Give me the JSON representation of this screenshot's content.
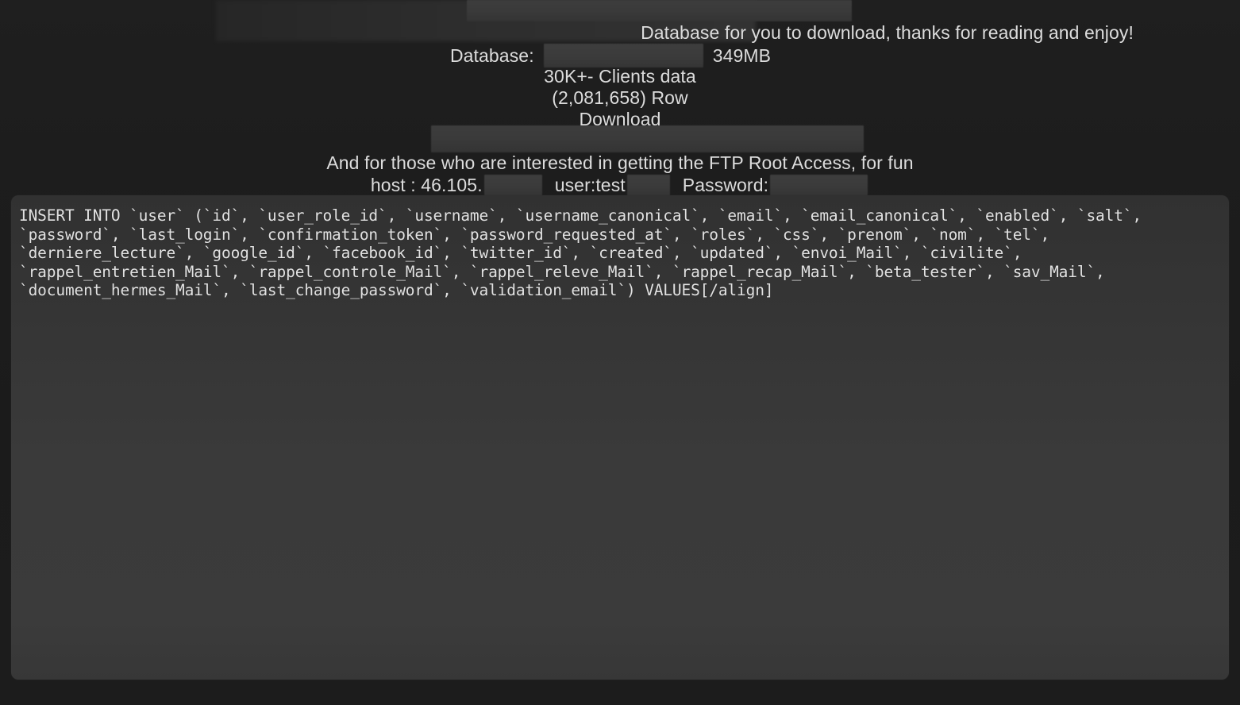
{
  "post": {
    "headline": "Database for you to download, thanks for reading and enjoy!",
    "database_label": "Database:",
    "database_name_redacted": "",
    "database_size": "349MB",
    "clients_count": "30K+- Clients data",
    "rows_count": "(2,081,658) Row",
    "download_label": "Download",
    "ftp_intro": "And for those who are interested in getting the FTP Root Access, for fun",
    "ftp": {
      "host_label": "host : 46.105.",
      "host_redacted": "",
      "user_label": "user:test",
      "user_redacted": "",
      "password_label": "Password:",
      "password_redacted": ""
    }
  },
  "code_block": {
    "language": "sql",
    "lines": [
      "INSERT INTO `user` (`id`, `user_role_id`, `username`, `username_canonical`, `email`, `email_canonical`, `enabled`, `salt`,",
      "`password`, `last_login`, `confirmation_token`, `password_requested_at`, `roles`, `css`, `prenom`, `nom`, `tel`,",
      "`derniere_lecture`, `google_id`, `facebook_id`, `twitter_id`, `created`, `updated`, `envoi_Mail`, `civilite`,",
      "`rappel_entretien_Mail`, `rappel_controle_Mail`, `rappel_releve_Mail`, `rappel_recap_Mail`, `beta_tester`, `sav_Mail`,",
      "`document_hermes_Mail`, `last_change_password`, `validation_email`) VALUES[/align]"
    ]
  },
  "colors": {
    "page_background": "#1c1c1c",
    "code_background": "#3a3a3a",
    "text": "#dcdcdc",
    "code_text": "#e2e2e2",
    "redaction_bar": "#3b3b3b"
  }
}
